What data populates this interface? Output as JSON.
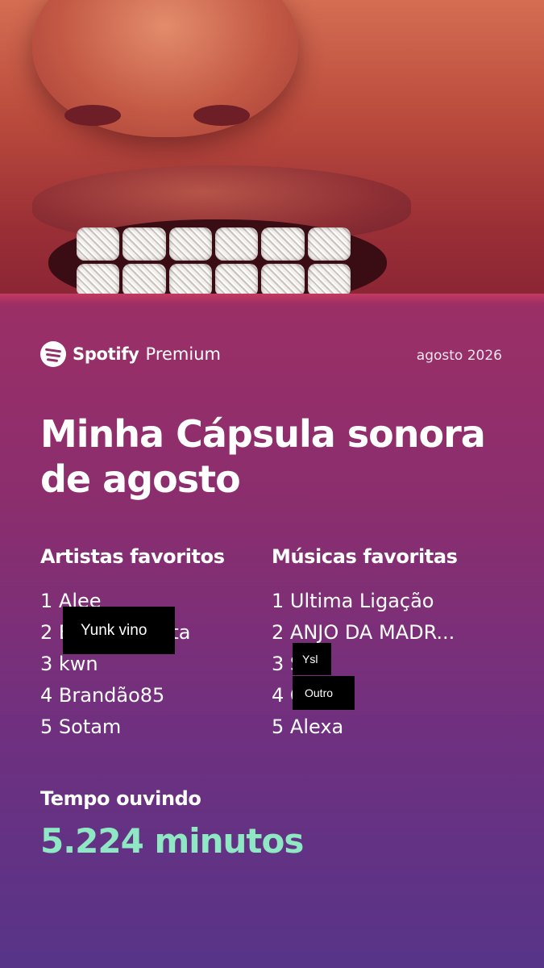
{
  "header": {
    "brand_name": "Spotify",
    "brand_tier": "Premium",
    "period": "agosto 2026"
  },
  "title": "Minha Cápsula sonora de agosto",
  "artists": {
    "heading": "Artistas favoritos",
    "items": [
      "1 Alee",
      "2 B",
      "3 kwn",
      "4 Brandão85",
      "5 Sotam"
    ],
    "item2_tail": "ta"
  },
  "songs": {
    "heading": "Músicas favoritas",
    "items": [
      "1 Ultima Ligação",
      "2 ANJO DA MADR...",
      "3 S",
      "4 C",
      "5 Alexa"
    ]
  },
  "redactions": {
    "artist_2": "Yunk vino",
    "song_3": "Ysl",
    "song_4": "Outro"
  },
  "listening": {
    "label": "Tempo ouvindo",
    "value": "5.224 minutos"
  },
  "colors": {
    "accent_value": "#8ee8c3",
    "panel_top": "#9b2f66",
    "panel_bottom": "#573488"
  },
  "icons": {
    "brand_logo": "spotify-logo-icon"
  }
}
